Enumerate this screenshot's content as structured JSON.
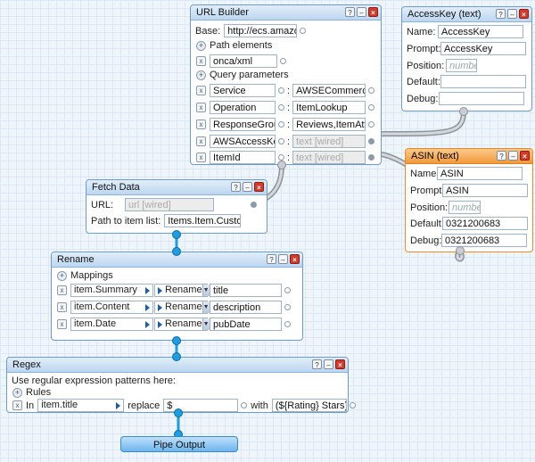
{
  "url_builder": {
    "title": "URL Builder",
    "base_label": "Base:",
    "base_value": "http://ecs.amazon",
    "path_elements_label": "Path elements",
    "path_value": "onca/xml",
    "query_label": "Query parameters",
    "params": [
      {
        "key": "Service",
        "value": "AWSECommerce",
        "wired": false
      },
      {
        "key": "Operation",
        "value": "ItemLookup",
        "wired": false
      },
      {
        "key": "ResponseGroup",
        "value": "Reviews,ItemAttrit",
        "wired": false
      },
      {
        "key": "AWSAccessKe",
        "value": "text [wired]",
        "wired": true
      },
      {
        "key": "ItemId",
        "value": "text [wired]",
        "wired": true
      }
    ],
    "colon": ":"
  },
  "accesskey": {
    "title": "AccessKey (text)",
    "name_label": "Name:",
    "name_value": "AccessKey",
    "prompt_label": "Prompt:",
    "prompt_value": "AccessKey",
    "position_label": "Position:",
    "position_placeholder": "numbe",
    "default_label": "Default:",
    "default_value": "",
    "debug_label": "Debug:",
    "debug_value": ""
  },
  "asin": {
    "title": "ASIN (text)",
    "name_label": "Name:",
    "name_value": "ASIN",
    "prompt_label": "Prompt:",
    "prompt_value": "ASIN",
    "position_label": "Position:",
    "position_placeholder": "numbe",
    "default_label": "Default:",
    "default_value": "0321200683",
    "debug_label": "Debug:",
    "debug_value": "0321200683"
  },
  "fetch": {
    "title": "Fetch Data",
    "url_label": "URL:",
    "url_value": "url [wired]",
    "path_label": "Path to item list:",
    "path_value": "Items.Item.Custor"
  },
  "rename": {
    "title": "Rename",
    "mappings_label": "Mappings",
    "rows": [
      {
        "field": "item.Summary",
        "op": "Rename",
        "target": "title"
      },
      {
        "field": "item.Content",
        "op": "Rename",
        "target": "description"
      },
      {
        "field": "item.Date",
        "op": "Rename",
        "target": "pubDate"
      }
    ]
  },
  "regex": {
    "title": "Regex",
    "intro": "Use regular expression patterns here:",
    "rules_label": "Rules",
    "in_label": "In",
    "in_value": "item.title",
    "replace_label": "replace",
    "replace_value": "$",
    "with_label": "with",
    "with_value": "(${Rating} Stars)"
  },
  "pipe_output": {
    "label": "Pipe Output"
  },
  "controls": {
    "help": "?",
    "min": "–",
    "close": "×",
    "remove": "x",
    "add": "+"
  },
  "colors": {
    "module_border": "#6b9bd1",
    "asin_border": "#f08a24",
    "port": "#1e9de0",
    "canvas": "#eef5fb"
  }
}
